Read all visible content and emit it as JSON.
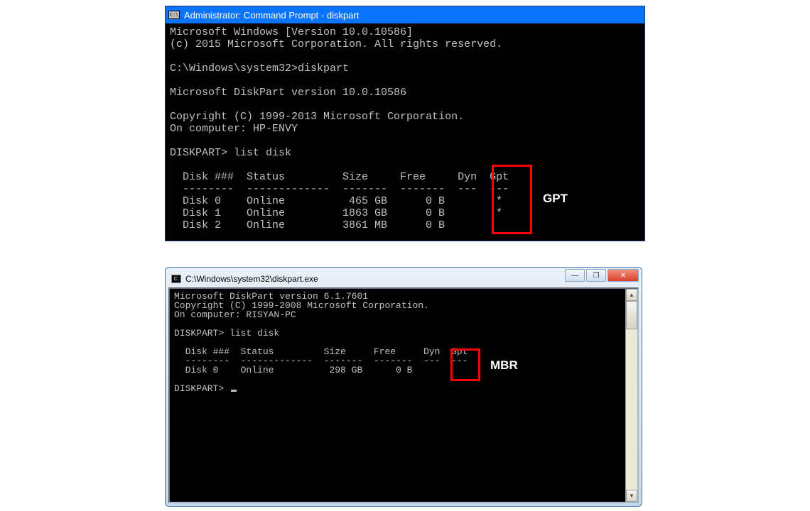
{
  "win10": {
    "title": "Administrator: Command Prompt - diskpart",
    "lines": {
      "l1": "Microsoft Windows [Version 10.0.10586]",
      "l2": "(c) 2015 Microsoft Corporation. All rights reserved.",
      "l3": "",
      "l4": "C:\\Windows\\system32>diskpart",
      "l5": "",
      "l6": "Microsoft DiskPart version 10.0.10586",
      "l7": "",
      "l8": "Copyright (C) 1999-2013 Microsoft Corporation.",
      "l9": "On computer: HP-ENVY",
      "l10": "",
      "l11": "DISKPART> list disk",
      "l12": "",
      "h": "  Disk ###  Status         Size     Free     Dyn  Gpt",
      "hr": "  --------  -------------  -------  -------  ---  ---",
      "d0": "  Disk 0    Online          465 GB      0 B        *",
      "d1": "  Disk 1    Online         1863 GB      0 B        *",
      "d2": "  Disk 2    Online         3861 MB      0 B"
    },
    "highlight_label": "GPT"
  },
  "win7": {
    "title": "C:\\Windows\\system32\\diskpart.exe",
    "lines": {
      "l1": "Microsoft DiskPart version 6.1.7601",
      "l2": "Copyright (C) 1999-2008 Microsoft Corporation.",
      "l3": "On computer: RISYAN-PC",
      "l4": "",
      "l5": "DISKPART> list disk",
      "l6": "",
      "h": "  Disk ###  Status         Size     Free     Dyn  Gpt",
      "hr": "  --------  -------------  -------  -------  ---  ---",
      "d0": "  Disk 0    Online          298 GB      0 B",
      "l7": "",
      "p": "DISKPART> "
    },
    "highlight_label": "MBR",
    "buttons": {
      "min": "—",
      "max": "❐",
      "close": "✕"
    },
    "scroll": {
      "up": "▲",
      "down": "▼"
    }
  }
}
